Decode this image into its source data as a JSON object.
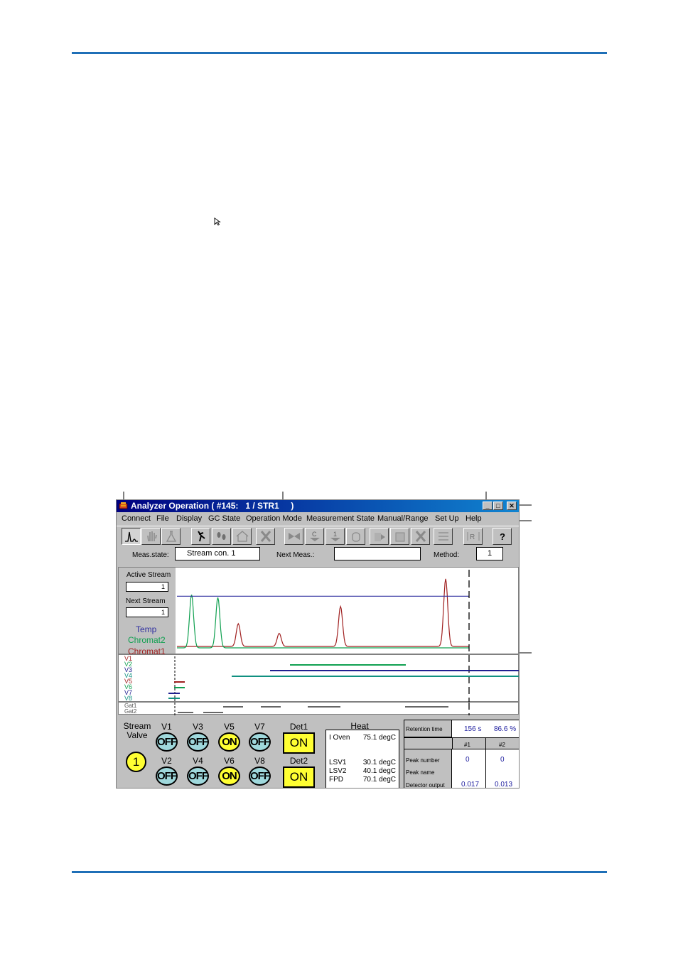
{
  "window": {
    "title": "Analyzer Operation ( #145:   1 / STR1     )",
    "minimize_symbol": "_",
    "maximize_symbol": "□",
    "close_symbol": "✕"
  },
  "menu": [
    "Connect",
    "File",
    "Display",
    "GC State",
    "Operation Mode",
    "Measurement State",
    "Manual/Range",
    "Set Up",
    "Help"
  ],
  "toolbar_icons": [
    "chromatogram-icon",
    "hand-icon",
    "flask-icon",
    "walk-icon",
    "footprints-icon",
    "house-icon",
    "stop-icon",
    "valve-icon",
    "calibration-icon",
    "stream-1-icon",
    "cylinder-icon",
    "start-icon",
    "page-icon",
    "cancel-icon",
    "list-icon",
    "range-icon",
    "help-icon"
  ],
  "status": {
    "meas_state_label": "Meas.state:",
    "meas_state_value": "Stream con. 1",
    "next_meas_label": "Next Meas.:",
    "next_meas_value": "",
    "method_label": "Method:",
    "method_value": "1"
  },
  "chart_side": {
    "active_stream_label": "Active Stream",
    "active_stream_value": "1",
    "next_stream_label": "Next Stream",
    "next_stream_value": "1",
    "legend": [
      {
        "name": "Temp",
        "color": "#3030a0"
      },
      {
        "name": "Chromat2",
        "color": "#10a050"
      },
      {
        "name": "Chromat1",
        "color": "#a02020"
      }
    ]
  },
  "chart_data": {
    "type": "line",
    "title": "",
    "xlabel": "",
    "ylabel": "",
    "series": [
      {
        "name": "Temp",
        "color": "#3030a0",
        "shape": "flat",
        "level": 0.75
      },
      {
        "name": "Chromat2",
        "color": "#10a050",
        "peaks": [
          {
            "pos": 0.05,
            "height": 0.77
          },
          {
            "pos": 0.14,
            "height": 0.73
          }
        ]
      },
      {
        "name": "Chromat1",
        "color": "#a02020",
        "peaks": [
          {
            "pos": 0.21,
            "height": 0.33
          },
          {
            "pos": 0.35,
            "height": 0.19
          },
          {
            "pos": 0.56,
            "height": 0.58
          },
          {
            "pos": 0.92,
            "height": 0.98
          }
        ]
      }
    ]
  },
  "valve_labels": [
    "V1",
    "V2",
    "V3",
    "V4",
    "V5",
    "V6",
    "V7",
    "V8"
  ],
  "gate_labels": [
    "Gat1",
    "Gat2"
  ],
  "bottom": {
    "stream_valve_label": "Stream\nValve",
    "stream_value": "1",
    "valves": [
      {
        "label": "V1",
        "state": "OFF"
      },
      {
        "label": "V3",
        "state": "OFF"
      },
      {
        "label": "V5",
        "state": "ON"
      },
      {
        "label": "V7",
        "state": "OFF"
      },
      {
        "label": "V2",
        "state": "OFF"
      },
      {
        "label": "V4",
        "state": "OFF"
      },
      {
        "label": "V6",
        "state": "ON"
      },
      {
        "label": "V8",
        "state": "OFF"
      }
    ],
    "det1_label": "Det1",
    "det1_state": "ON",
    "det2_label": "Det2",
    "det2_state": "ON",
    "heat_label": "Heat",
    "heat": [
      {
        "name": "I  Oven",
        "value": "75.1 degC"
      },
      {
        "name": "LSV1",
        "value": "30.1 degC"
      },
      {
        "name": "LSV2",
        "value": "40.1 degC"
      },
      {
        "name": "FPD",
        "value": "70.1 degC"
      }
    ],
    "retention_label": "Retention time",
    "retention_value": "156  s",
    "retention_percent": "86.6 %",
    "col1": "#1",
    "col2": "#2",
    "peak_number_label": "Peak number",
    "peak_number_1": "0",
    "peak_number_2": "0",
    "peak_name_label": "Peak name",
    "detector_output_label": "Detector output",
    "detector_output_1": "0.017",
    "detector_output_2": "0.013"
  }
}
